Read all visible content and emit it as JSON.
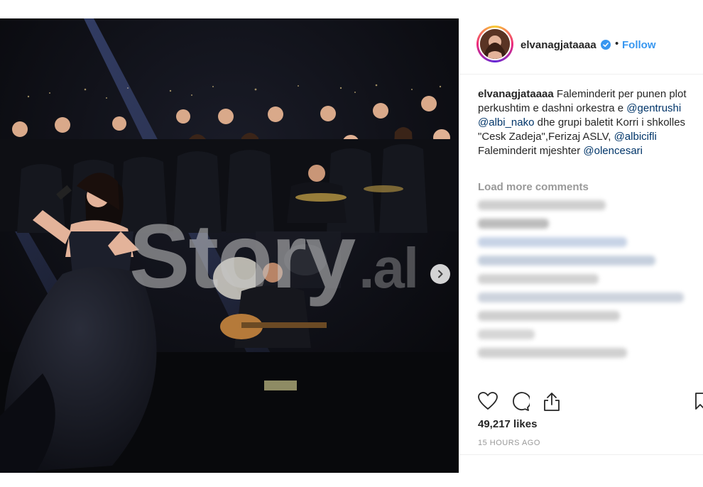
{
  "post": {
    "username": "elvanagjataaaa",
    "verified": true,
    "dot": "•",
    "follow_label": "Follow",
    "watermark": {
      "main": "Story",
      "suffix": ".al"
    },
    "caption": {
      "username": "elvanagjataaaa",
      "line1": " Faleminderit per punen plot perkushtim e dashni orkestra e ",
      "mention1": "@gentrushi",
      "mention2": "@albi_nako",
      "line2": " dhe grupi baletit Korri i shkolles \"Cesk Zadeja\",Ferizaj ASLV, ",
      "mention3": "@albicifli",
      "line3": "Faleminderit mjeshter ",
      "mention4": "@olencesari"
    },
    "load_more": "Load more comments",
    "likes": "49,217 likes",
    "timestamp": "15 HOURS AGO"
  },
  "icons": {
    "like": "heart-icon",
    "comment": "comment-icon",
    "share": "share-icon",
    "save": "bookmark-icon",
    "next": "chevron-right-icon",
    "verified": "verified-badge-icon"
  },
  "colors": {
    "accent": "#3897f0",
    "verified": "#3897f0",
    "mention": "#003569",
    "muted": "#999999"
  }
}
